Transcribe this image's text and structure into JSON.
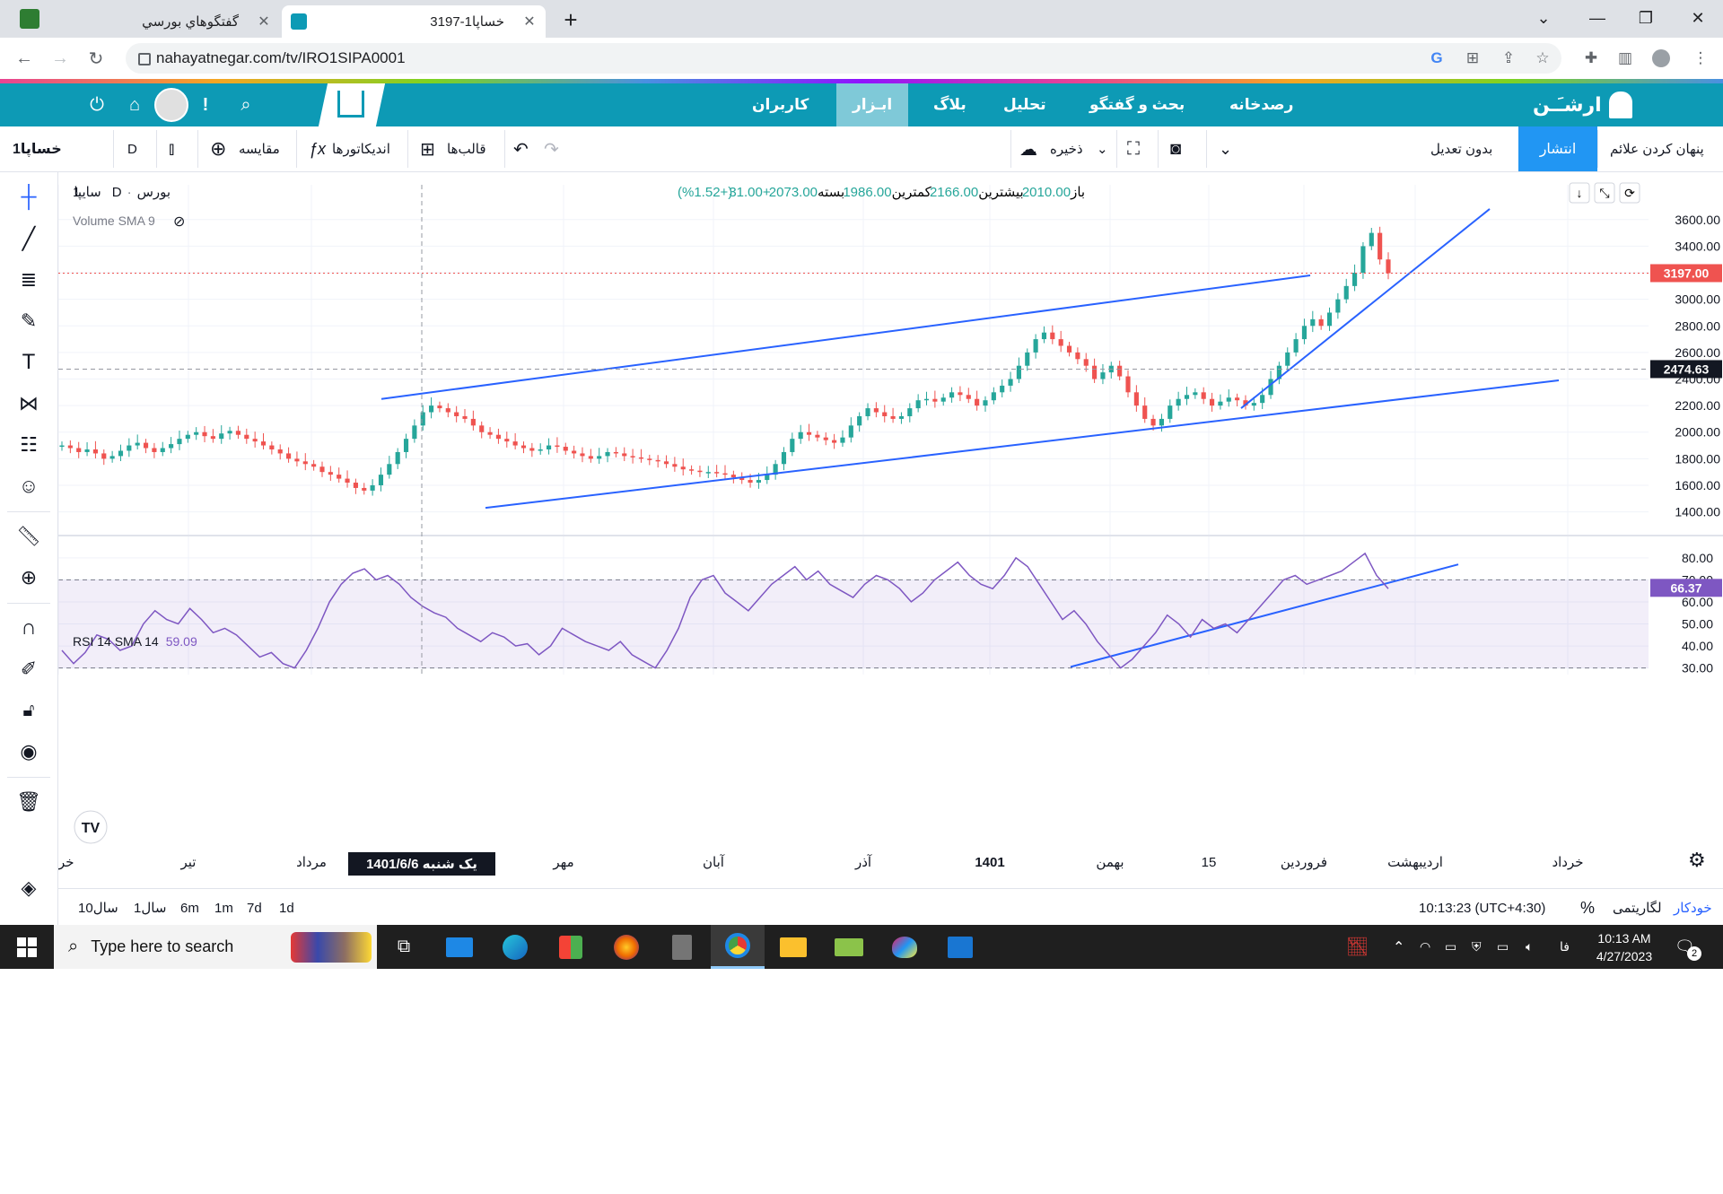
{
  "browser": {
    "tabs": [
      {
        "title": "گفتگوهاي بورسي",
        "active": false
      },
      {
        "title": "خساپا1-3197",
        "active": true
      }
    ],
    "new_tab": "+",
    "url": "nahayatnegar.com/tv/IRO1SIPA0001"
  },
  "site_nav": {
    "brand": "ارشـَـن",
    "items": [
      {
        "label": "رصدخانه"
      },
      {
        "label": "بحث و گفتگو"
      },
      {
        "label": "تحلیل"
      },
      {
        "label": "بلاگ"
      },
      {
        "label": "ابـزار"
      },
      {
        "label": "کاربران"
      }
    ],
    "alert": "!"
  },
  "toolbar": {
    "symbol": "خساپا1",
    "interval": "D",
    "compare": "مقایسه",
    "indicators": "اندیکاتورها",
    "templates": "قالب‌ها",
    "save": "ذخیره",
    "adjust": "بدون تعدیل",
    "publish": "انتشار",
    "hide_marks": "پنهان کردن علائم"
  },
  "legend": {
    "name": "سایپا",
    "interval": "1D",
    "exchange": "بورس",
    "open_label": "باز",
    "open": "2010.00",
    "high_label": "بیشترین",
    "high": "2166.00",
    "low_label": "کمترین",
    "low": "1986.00",
    "close_label": "بسته",
    "close": "2073.00",
    "change": "+31.00",
    "change_pct": "(+1.52%)",
    "volume_label": "Volume SMA 9",
    "rsi_label": "RSI 14 SMA 14",
    "rsi_value": "59.09"
  },
  "chart_data": {
    "type": "candlestick",
    "price_axis": [
      "3600.00",
      "3400.00",
      "3200.00",
      "3000.00",
      "2800.00",
      "2600.00",
      "2400.00",
      "2200.00",
      "2000.00",
      "1800.00",
      "1600.00",
      "1400.00"
    ],
    "price_range": [
      1350,
      3700
    ],
    "last_price": "3197.00",
    "crosshair_price": "2474.63",
    "rsi_axis": [
      "80.00",
      "70.00",
      "60.00",
      "50.00",
      "40.00",
      "30.00"
    ],
    "rsi_range": [
      27,
      84
    ],
    "rsi_last": "66.37",
    "time_labels": [
      "خرداد",
      "تیر",
      "مرداد",
      "مهر",
      "آبان",
      "آذر",
      "1401",
      "بهمن",
      "15",
      "فروردین",
      "اردیبهشت",
      "خرداد"
    ],
    "crosshair_date": "یک شنبه   1401/6/6",
    "close_series": [
      1900,
      1880,
      1850,
      1870,
      1840,
      1800,
      1820,
      1860,
      1900,
      1920,
      1880,
      1850,
      1880,
      1910,
      1950,
      1980,
      2000,
      1970,
      1950,
      1990,
      2010,
      1980,
      1950,
      1930,
      1900,
      1870,
      1840,
      1800,
      1780,
      1760,
      1740,
      1700,
      1680,
      1650,
      1620,
      1580,
      1560,
      1600,
      1680,
      1760,
      1850,
      1950,
      2050,
      2150,
      2200,
      2180,
      2150,
      2120,
      2100,
      2050,
      2000,
      1980,
      1950,
      1930,
      1900,
      1880,
      1860,
      1870,
      1900,
      1890,
      1860,
      1840,
      1820,
      1800,
      1820,
      1850,
      1840,
      1820,
      1810,
      1800,
      1790,
      1780,
      1760,
      1740,
      1720,
      1710,
      1700,
      1700,
      1690,
      1680,
      1660,
      1640,
      1620,
      1640,
      1680,
      1760,
      1850,
      1950,
      2000,
      1980,
      1960,
      1940,
      1920,
      1960,
      2050,
      2120,
      2180,
      2150,
      2120,
      2100,
      2120,
      2180,
      2240,
      2250,
      2230,
      2260,
      2300,
      2280,
      2250,
      2200,
      2240,
      2300,
      2350,
      2400,
      2500,
      2600,
      2700,
      2750,
      2700,
      2650,
      2600,
      2550,
      2500,
      2400,
      2450,
      2500,
      2420,
      2300,
      2200,
      2100,
      2050,
      2100,
      2200,
      2250,
      2280,
      2300,
      2250,
      2200,
      2230,
      2260,
      2240,
      2200,
      2220,
      2280,
      2400,
      2500,
      2600,
      2700,
      2800,
      2850,
      2800,
      2900,
      3000,
      3100,
      3200,
      3400,
      3500,
      3300,
      3197
    ],
    "rsi_series": [
      38,
      32,
      37,
      45,
      43,
      38,
      40,
      50,
      56,
      52,
      50,
      57,
      52,
      46,
      48,
      45,
      40,
      35,
      37,
      32,
      30,
      38,
      48,
      60,
      68,
      73,
      75,
      70,
      72,
      68,
      62,
      58,
      55,
      53,
      48,
      45,
      42,
      46,
      44,
      40,
      41,
      36,
      40,
      48,
      45,
      42,
      40,
      38,
      42,
      36,
      33,
      30,
      38,
      48,
      62,
      70,
      72,
      64,
      60,
      56,
      62,
      68,
      72,
      76,
      70,
      74,
      68,
      65,
      62,
      68,
      72,
      70,
      66,
      60,
      64,
      70,
      74,
      78,
      72,
      68,
      66,
      72,
      80,
      76,
      68,
      60,
      52,
      56,
      50,
      42,
      36,
      30,
      34,
      40,
      46,
      54,
      50,
      44,
      52,
      48,
      50,
      46,
      52,
      58,
      64,
      70,
      72,
      68,
      70,
      72,
      74,
      78,
      82,
      72,
      66
    ]
  },
  "bottom_bar": {
    "ranges": [
      "1d",
      "7d",
      "1m",
      "6m",
      "1سال",
      "10سال"
    ],
    "time": "10:13:23 (UTC+4:30)",
    "percent": "%",
    "log": "لگاریتمی",
    "auto": "خودکار"
  },
  "taskbar": {
    "search_placeholder": "Type here to search",
    "lang": "فا",
    "time": "10:13 AM",
    "date": "4/27/2023",
    "notifications": "2"
  },
  "colors": {
    "nav": "#0d9ab5",
    "up": "#26a69a",
    "down": "#ef5350",
    "trend": "#2962ff",
    "rsi": "#7e57c2",
    "publish": "#2196f3"
  }
}
